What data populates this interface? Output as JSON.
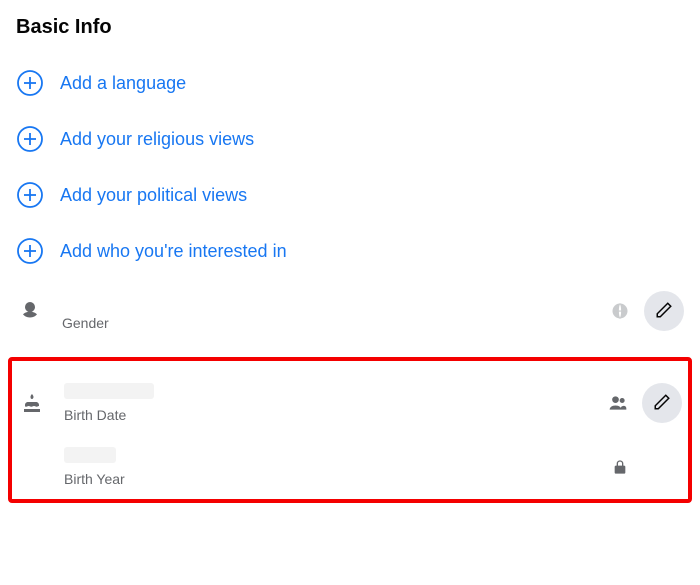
{
  "section_title": "Basic Info",
  "add_rows": [
    {
      "label": "Add a language"
    },
    {
      "label": "Add your religious views"
    },
    {
      "label": "Add your political views"
    },
    {
      "label": "Add who you're interested in"
    }
  ],
  "gender": {
    "label": "Gender",
    "value": "",
    "privacy": "public"
  },
  "birth_date": {
    "label": "Birth Date",
    "value": "",
    "privacy": "friends"
  },
  "birth_year": {
    "label": "Birth Year",
    "value": "",
    "privacy": "only_me"
  }
}
